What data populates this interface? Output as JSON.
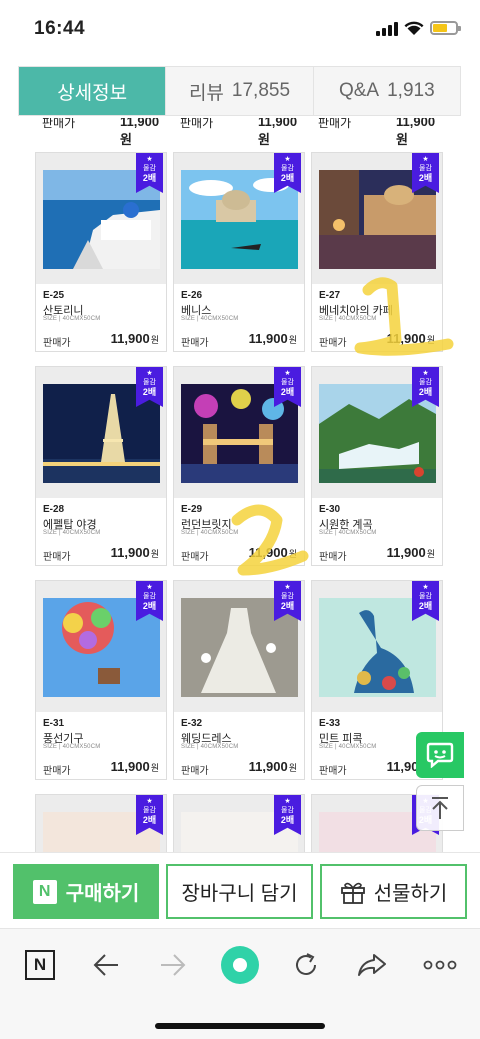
{
  "status_bar": {
    "time": "16:44"
  },
  "tabs": [
    {
      "label": "상세정보",
      "count": ""
    },
    {
      "label": "리뷰",
      "count": "17,855"
    },
    {
      "label": "Q&A",
      "count": "1,913"
    }
  ],
  "partial_row": {
    "price_label": "판매가",
    "price": "11,900원"
  },
  "ribbon": {
    "line1": "물감",
    "line2": "2배"
  },
  "products": [
    {
      "code": "E-25",
      "name": "산토리니",
      "size": "SIZE | 40CMX50CM",
      "price_label": "판매가",
      "price": "11,900",
      "currency": "원"
    },
    {
      "code": "E-26",
      "name": "베니스",
      "size": "SIZE | 40CMX50CM",
      "price_label": "판매가",
      "price": "11,900",
      "currency": "원"
    },
    {
      "code": "E-27",
      "name": "베네치아의 카페",
      "size": "SIZE | 40CMX50CM",
      "price_label": "판매가",
      "price": "11,900",
      "currency": "원"
    },
    {
      "code": "E-28",
      "name": "에펠탑 야경",
      "size": "SIZE | 40CMX50CM",
      "price_label": "판매가",
      "price": "11,900",
      "currency": "원"
    },
    {
      "code": "E-29",
      "name": "런던브릿지",
      "size": "SIZE | 40CMX50CM",
      "price_label": "판매가",
      "price": "11,900",
      "currency": "원"
    },
    {
      "code": "E-30",
      "name": "시원한 계곡",
      "size": "SIZE | 40CMX50CM",
      "price_label": "판매가",
      "price": "11,900",
      "currency": "원"
    },
    {
      "code": "E-31",
      "name": "풍선기구",
      "size": "SIZE | 40CMX50CM",
      "price_label": "판매가",
      "price": "11,900",
      "currency": "원"
    },
    {
      "code": "E-32",
      "name": "웨딩드레스",
      "size": "SIZE | 40CMX50CM",
      "price_label": "판매가",
      "price": "11,900",
      "currency": "원"
    },
    {
      "code": "E-33",
      "name": "민트 피콕",
      "size": "SIZE | 40CMX50CM",
      "price_label": "판매가",
      "price": "11,900",
      "currency": "원"
    }
  ],
  "actions": {
    "buy": "구매하기",
    "cart": "장바구니 담기",
    "gift": "선물하기",
    "n_badge": "N"
  },
  "browser": {
    "home_badge": "N"
  },
  "colors": {
    "accent": "#4cb8a8",
    "naver_green": "#52c16b",
    "ribbon": "#4a1ce0",
    "highlight": "#f5d23c"
  }
}
